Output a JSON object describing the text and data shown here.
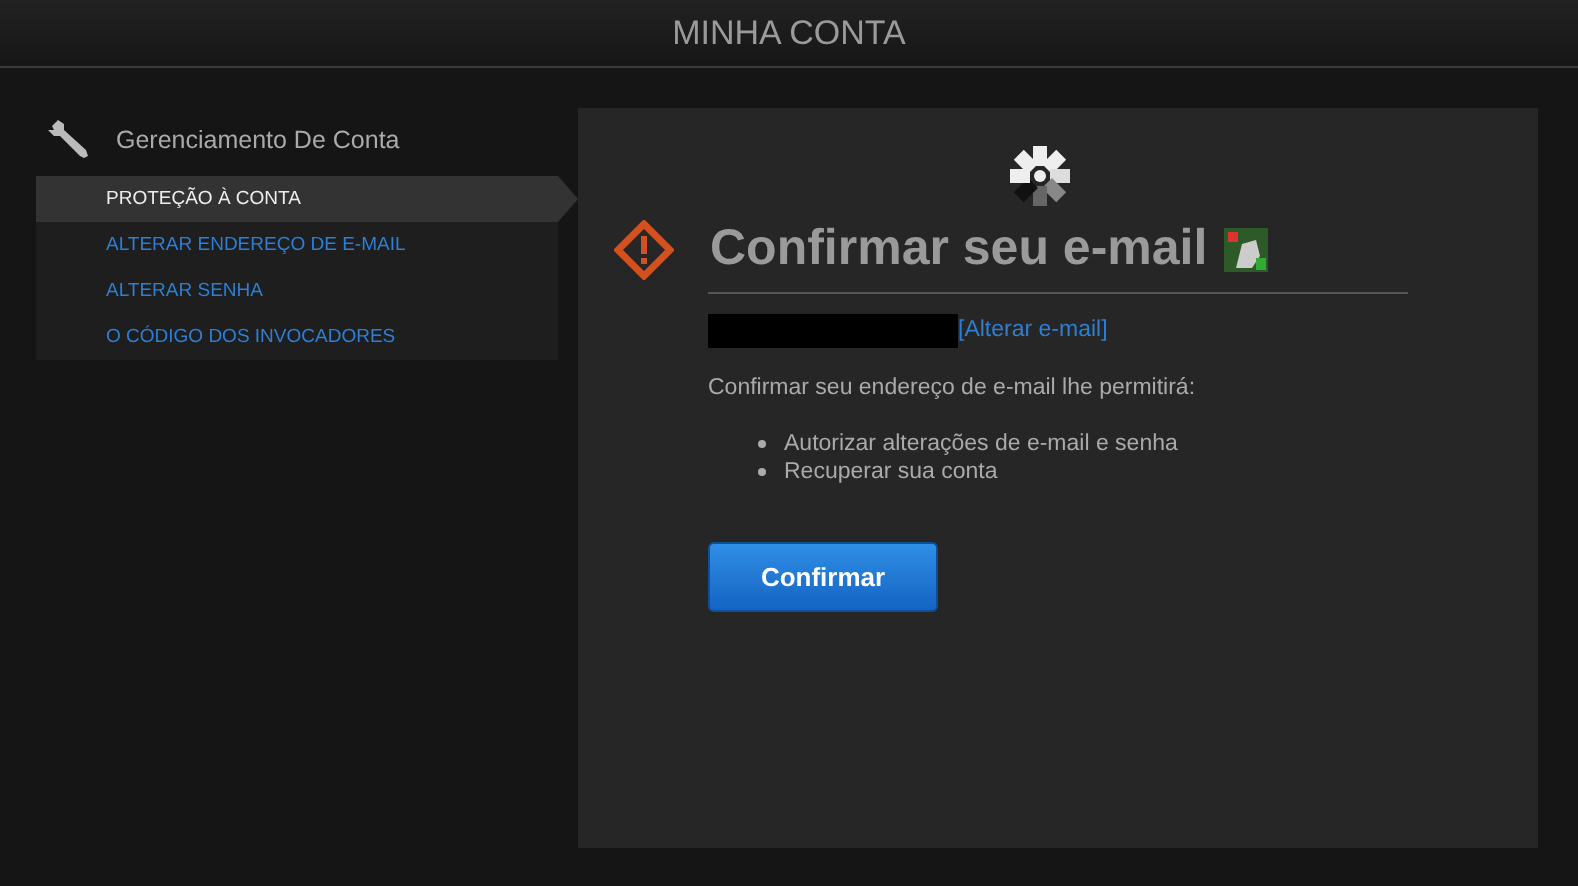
{
  "header": {
    "title": "MINHA CONTA"
  },
  "sidebar": {
    "title": "Gerenciamento De Conta",
    "items": [
      {
        "label": "PROTEÇÃO À CONTA",
        "selected": true
      },
      {
        "label": "ALTERAR ENDEREÇO DE E-MAIL",
        "selected": false
      },
      {
        "label": "ALTERAR SENHA",
        "selected": false
      },
      {
        "label": "O CÓDIGO DOS INVOCADORES",
        "selected": false
      }
    ]
  },
  "main": {
    "heading": "Confirmar seu e-mail",
    "change_link": "[Alterar e-mail]",
    "intro": "Confirmar seu endereço de e-mail lhe permitirá:",
    "bullets": [
      "Autorizar alterações de e-mail e senha",
      "Recuperar sua conta"
    ],
    "button": "Confirmar"
  }
}
